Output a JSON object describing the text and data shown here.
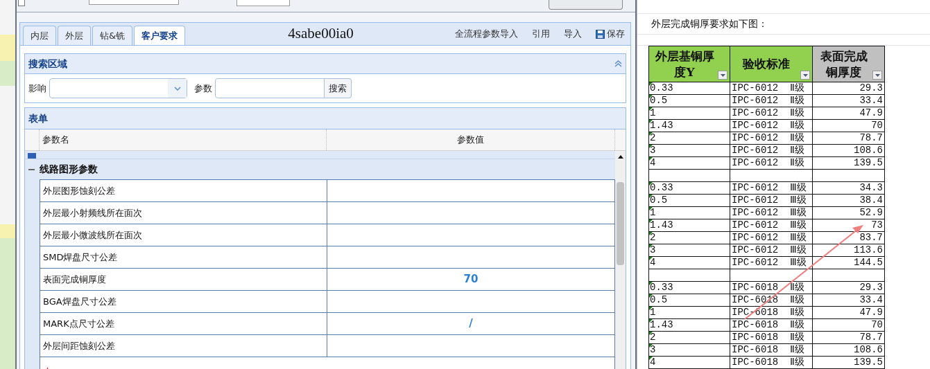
{
  "dialog": {
    "top_bar": {
      "checkbox": {
        "checked": false
      }
    },
    "tabs": [
      {
        "label": "内层",
        "selected": false
      },
      {
        "label": "外层",
        "selected": false
      },
      {
        "label": "钻&铣",
        "selected": false
      },
      {
        "label": "客户要求",
        "selected": true
      }
    ],
    "code": "4sabe00ia0",
    "actions": [
      {
        "label": "全流程参数导入",
        "kind": "text"
      },
      {
        "label": "引用",
        "kind": "text"
      },
      {
        "label": "导入",
        "kind": "text"
      },
      {
        "label": "保存",
        "kind": "save"
      }
    ],
    "search_panel": {
      "title": "搜索区域",
      "expanded": true,
      "fields": [
        {
          "label": "影响",
          "kind": "select"
        },
        {
          "label": "参数",
          "kind": "text"
        }
      ],
      "button": "搜索"
    },
    "form_panel": {
      "title": "表单",
      "columns": [
        "参数名",
        "参数值"
      ],
      "group": {
        "label": "线路图形参数",
        "expanded": true
      },
      "rows": [
        {
          "name": "外层图形蚀刻公差",
          "value": ""
        },
        {
          "name": "外层最小射频线所在面次",
          "value": ""
        },
        {
          "name": "外层最小微波线所在面次",
          "value": ""
        },
        {
          "name": "SMD焊盘尺寸公差",
          "value": ""
        },
        {
          "name": "表面完成铜厚度",
          "value": "70"
        },
        {
          "name": "BGA焊盘尺寸公差",
          "value": ""
        },
        {
          "name": "MARK点尺寸公差",
          "value": "/"
        },
        {
          "name": "外层间距蚀刻公差",
          "value": ""
        }
      ]
    }
  },
  "sheet": {
    "caption": "外层完成铜厚要求如下图：",
    "columns": [
      {
        "label": "外层基铜厚度Y",
        "color": "#92d050"
      },
      {
        "label": "验收标准",
        "color": "#92d050"
      },
      {
        "label": "表面完成铜厚度",
        "color": "#c0c0c0"
      }
    ],
    "groups": [
      [
        {
          "base": "0.33",
          "standard": "IPC-6012  Ⅱ级",
          "thickness": "29.3"
        },
        {
          "base": "0.5",
          "standard": "IPC-6012  Ⅱ级",
          "thickness": "33.4"
        },
        {
          "base": "1",
          "standard": "IPC-6012  Ⅱ级",
          "thickness": "47.9"
        },
        {
          "base": "1.43",
          "standard": "IPC-6012  Ⅱ级",
          "thickness": "70"
        },
        {
          "base": "2",
          "standard": "IPC-6012  Ⅱ级",
          "thickness": "78.7"
        },
        {
          "base": "3",
          "standard": "IPC-6012  Ⅱ级",
          "thickness": "108.6"
        },
        {
          "base": "4",
          "standard": "IPC-6012  Ⅱ级",
          "thickness": "139.5"
        }
      ],
      [
        {
          "base": "0.33",
          "standard": "IPC-6012  Ⅲ级",
          "thickness": "34.3"
        },
        {
          "base": "0.5",
          "standard": "IPC-6012  Ⅲ级",
          "thickness": "38.4"
        },
        {
          "base": "1",
          "standard": "IPC-6012  Ⅲ级",
          "thickness": "52.9"
        },
        {
          "base": "1.43",
          "standard": "IPC-6012  Ⅲ级",
          "thickness": "73"
        },
        {
          "base": "2",
          "standard": "IPC-6012  Ⅲ级",
          "thickness": "83.7"
        },
        {
          "base": "3",
          "standard": "IPC-6012  Ⅲ级",
          "thickness": "113.6"
        },
        {
          "base": "4",
          "standard": "IPC-6012  Ⅲ级",
          "thickness": "144.5"
        }
      ],
      [
        {
          "base": "0.33",
          "standard": "IPC-6018  Ⅱ级",
          "thickness": "29.3"
        },
        {
          "base": "0.5",
          "standard": "IPC-6018  Ⅱ级",
          "thickness": "33.4"
        },
        {
          "base": "1",
          "standard": "IPC-6018  Ⅱ级",
          "thickness": "47.9"
        },
        {
          "base": "1.43",
          "standard": "IPC-6018  Ⅱ级",
          "thickness": "70"
        },
        {
          "base": "2",
          "standard": "IPC-6018  Ⅱ级",
          "thickness": "78.7"
        },
        {
          "base": "3",
          "standard": "IPC-6018  Ⅱ级",
          "thickness": "108.6"
        },
        {
          "base": "4",
          "standard": "IPC-6018  Ⅱ级",
          "thickness": "139.5"
        }
      ]
    ]
  }
}
